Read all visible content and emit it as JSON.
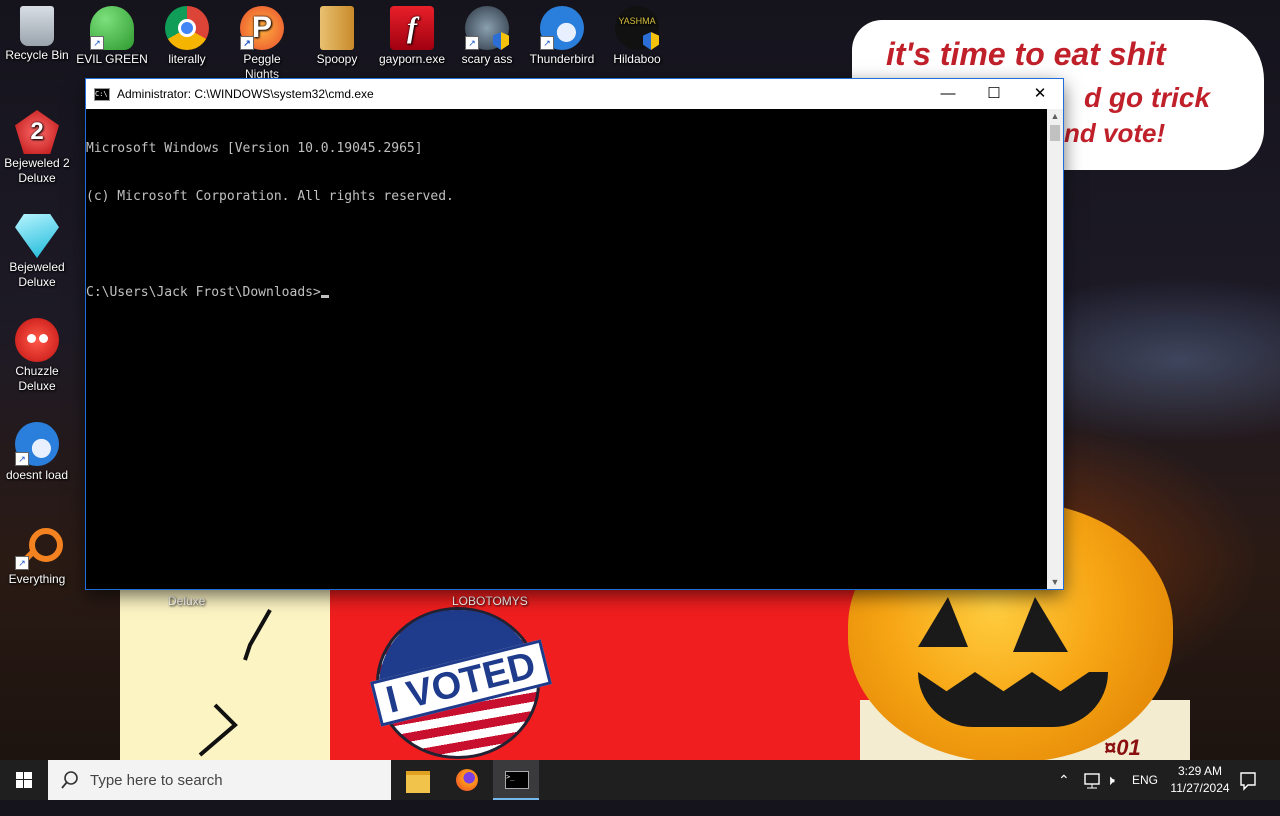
{
  "wallpaper": {
    "bubble_line1": "it's time to eat shit",
    "bubble_line2": "d go trick",
    "bubble_line3": "nd vote!",
    "sticker_text": "I VOTED",
    "partial_label_deluxe": "Deluxe",
    "partial_label_lobotomys": "LOBOTOMYS"
  },
  "desktop_icons": [
    {
      "label": "Recycle Bin",
      "icon": "recycle-bin-icon",
      "color": "#b8c0c8"
    },
    {
      "label": "EVIL GREEN MEN GO",
      "icon": "green-men-icon",
      "color": "#3db53d"
    },
    {
      "label": "literally",
      "icon": "chrome-icon",
      "color": "#4285f4"
    },
    {
      "label": "Peggle Nights",
      "icon": "peggle-icon",
      "color": "#e84c2c"
    },
    {
      "label": "Spoopy",
      "icon": "folder-icon",
      "color": "#d9a64a"
    },
    {
      "label": "gayporn.exe",
      "icon": "flash-icon",
      "color": "#c8102e"
    },
    {
      "label": "scary ass",
      "icon": "scary-icon",
      "color": "#5b6b7a"
    },
    {
      "label": "Thunderbird",
      "icon": "thunderbird-icon",
      "color": "#2b7fdc"
    },
    {
      "label": "Hildaboo",
      "icon": "yashma-icon",
      "color": "#2a2a2a"
    },
    {
      "label": "Bejeweled 2 Deluxe",
      "icon": "bejeweled2-icon",
      "color": "#d82a2a"
    },
    {
      "label": "Bejeweled Deluxe",
      "icon": "diamond-icon",
      "color": "#35d0e8"
    },
    {
      "label": "Chuzzle Deluxe",
      "icon": "chuzzle-icon",
      "color": "#e23a2a"
    },
    {
      "label": "doesnt load",
      "icon": "thunderbird-icon",
      "color": "#2b7fdc"
    },
    {
      "label": "Everything",
      "icon": "everything-icon",
      "color": "#f58220"
    }
  ],
  "cmd": {
    "title": "Administrator: C:\\WINDOWS\\system32\\cmd.exe",
    "line1": "Microsoft Windows [Version 10.0.19045.2965]",
    "line2": "(c) Microsoft Corporation. All rights reserved.",
    "prompt": "C:\\Users\\Jack Frost\\Downloads>"
  },
  "taskbar": {
    "search_placeholder": "Type here to search",
    "language": "ENG",
    "time": "3:29 AM",
    "date": "11/27/2024"
  }
}
